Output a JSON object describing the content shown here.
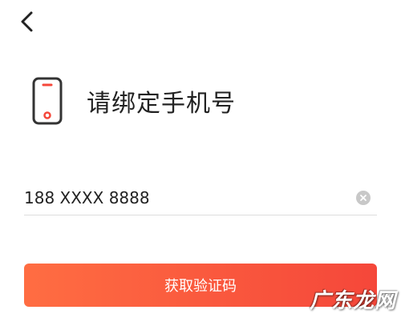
{
  "colors": {
    "accent": "#f5473a",
    "accent_light": "#ff6d42",
    "title_text": "#222222",
    "divider": "#dddddd",
    "clear_icon": "#c8c8c8"
  },
  "nav": {
    "back_icon": "chevron-left-icon"
  },
  "header": {
    "icon": "phone-icon",
    "title": "请绑定手机号"
  },
  "phone_field": {
    "value": "188 XXXX 8888",
    "clear_icon": "clear-icon"
  },
  "submit": {
    "label": "获取验证码"
  },
  "watermark": {
    "text": "广东龙网"
  }
}
